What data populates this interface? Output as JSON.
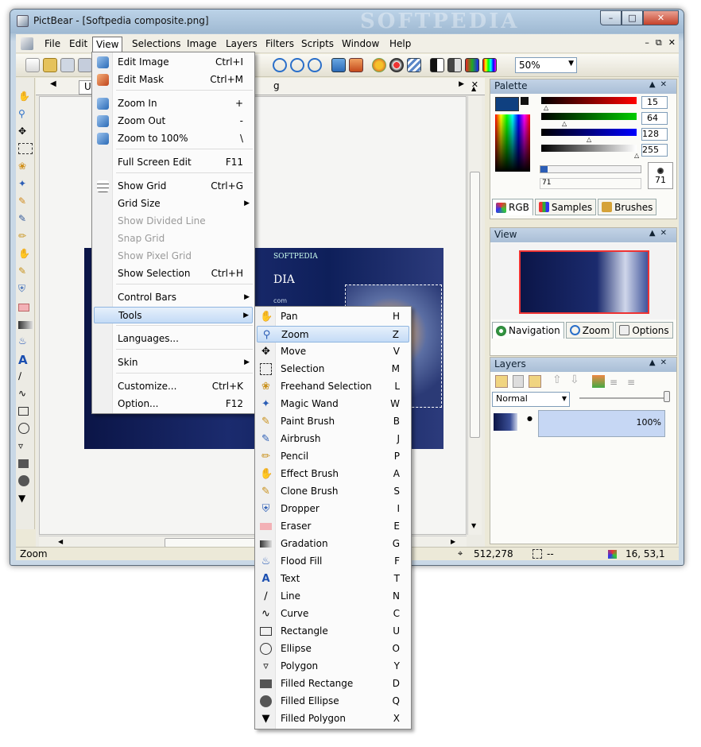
{
  "window": {
    "title": "PictBear - [Softpedia composite.png]",
    "watermark": "SOFTPEDIA"
  },
  "menubar": [
    "File",
    "Edit",
    "View",
    "Selections",
    "Image",
    "Layers",
    "Filters",
    "Scripts",
    "Window",
    "Help"
  ],
  "toolbar": {
    "zoom_value": "50%"
  },
  "doc_tabs": {
    "tab1": "U",
    "tab2": "g"
  },
  "view_menu": [
    {
      "label": "Edit Image",
      "shortcut": "Ctrl+I",
      "icon": "edit-image-icon"
    },
    {
      "label": "Edit Mask",
      "shortcut": "Ctrl+M",
      "icon": "edit-mask-icon"
    },
    {
      "label": "Zoom In",
      "shortcut": "+",
      "icon": "zoom-in-icon"
    },
    {
      "label": "Zoom Out",
      "shortcut": "-",
      "icon": "zoom-out-icon"
    },
    {
      "label": "Zoom to 100%",
      "shortcut": "\\",
      "icon": "zoom-100-icon"
    },
    {
      "label": "Full Screen Edit",
      "shortcut": "F11"
    },
    {
      "label": "Show Grid",
      "shortcut": "Ctrl+G",
      "icon": "grid-icon"
    },
    {
      "label": "Grid Size"
    },
    {
      "label": "Show Divided Line",
      "disabled": true
    },
    {
      "label": "Snap Grid",
      "disabled": true
    },
    {
      "label": "Show Pixel Grid",
      "disabled": true
    },
    {
      "label": "Show Selection",
      "shortcut": "Ctrl+H"
    },
    {
      "label": "Control Bars"
    },
    {
      "label": "Tools"
    },
    {
      "label": "Languages..."
    },
    {
      "label": "Skin"
    },
    {
      "label": "Customize...",
      "shortcut": "Ctrl+K"
    },
    {
      "label": "Option...",
      "shortcut": "F12"
    }
  ],
  "tools_menu": [
    {
      "label": "Pan",
      "shortcut": "H",
      "icon": "hand-icon"
    },
    {
      "label": "Zoom",
      "shortcut": "Z",
      "icon": "magnifier-icon"
    },
    {
      "label": "Move",
      "shortcut": "V",
      "icon": "move-icon"
    },
    {
      "label": "Selection",
      "shortcut": "M",
      "icon": "selection-icon"
    },
    {
      "label": "Freehand Selection",
      "shortcut": "L",
      "icon": "lasso-icon"
    },
    {
      "label": "Magic Wand",
      "shortcut": "W",
      "icon": "magic-wand-icon"
    },
    {
      "label": "Paint Brush",
      "shortcut": "B",
      "icon": "paint-brush-icon"
    },
    {
      "label": "Airbrush",
      "shortcut": "J",
      "icon": "airbrush-icon"
    },
    {
      "label": "Pencil",
      "shortcut": "P",
      "icon": "pencil-icon"
    },
    {
      "label": "Effect Brush",
      "shortcut": "A",
      "icon": "effect-brush-icon"
    },
    {
      "label": "Clone Brush",
      "shortcut": "S",
      "icon": "clone-brush-icon"
    },
    {
      "label": "Dropper",
      "shortcut": "I",
      "icon": "dropper-icon"
    },
    {
      "label": "Eraser",
      "shortcut": "E",
      "icon": "eraser-icon"
    },
    {
      "label": "Gradation",
      "shortcut": "G",
      "icon": "gradient-icon"
    },
    {
      "label": "Flood Fill",
      "shortcut": "F",
      "icon": "bucket-icon"
    },
    {
      "label": "Text",
      "shortcut": "T",
      "icon": "text-icon"
    },
    {
      "label": "Line",
      "shortcut": "N",
      "icon": "line-icon"
    },
    {
      "label": "Curve",
      "shortcut": "C",
      "icon": "curve-icon"
    },
    {
      "label": "Rectangle",
      "shortcut": "U",
      "icon": "rectangle-icon"
    },
    {
      "label": "Ellipse",
      "shortcut": "O",
      "icon": "ellipse-icon"
    },
    {
      "label": "Polygon",
      "shortcut": "Y",
      "icon": "polygon-icon"
    },
    {
      "label": "Filled Rectange",
      "shortcut": "D",
      "icon": "filled-rectangle-icon"
    },
    {
      "label": "Filled Ellipse",
      "shortcut": "Q",
      "icon": "filled-ellipse-icon"
    },
    {
      "label": "Filled Polygon",
      "shortcut": "X",
      "icon": "filled-polygon-icon"
    }
  ],
  "palette": {
    "title": "Palette",
    "r": "15",
    "g": "64",
    "b": "128",
    "a": "255",
    "brush_size": "71",
    "size_label": "71",
    "tabs": [
      "RGB",
      "Samples",
      "Brushes"
    ],
    "fg_color": "#0f4080"
  },
  "view_panel": {
    "title": "View",
    "tabs": [
      "Navigation",
      "Zoom",
      "Options"
    ]
  },
  "layers_panel": {
    "title": "Layers",
    "blend_mode": "Normal",
    "opacity": "100%"
  },
  "status": {
    "text": "Zoom",
    "pos": "512,278",
    "size": "--",
    "color": "16, 53,1"
  },
  "canvas": {
    "brand": "SOFTPEDIA",
    "fragment": "DIA",
    "fragment2": "com"
  }
}
